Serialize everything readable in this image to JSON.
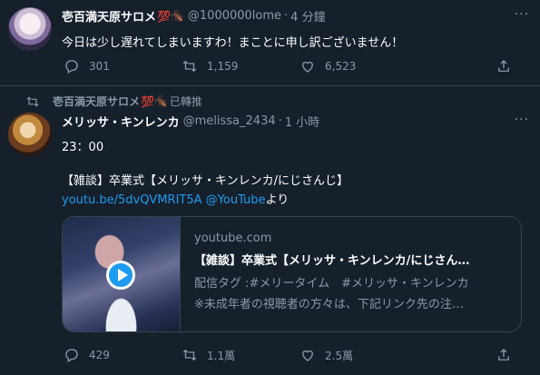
{
  "tweet1": {
    "display_name": "壱百満天原サロメ",
    "emoji": "💯🪳",
    "handle": "@1000000lome",
    "time": "4 分鐘",
    "text": "今日は少し遅れてしまいますわ！まことに申し訳ございません！",
    "replies": "301",
    "retweets": "1,159",
    "likes": "6,523"
  },
  "tweet2": {
    "retweeter_name": "壱百満天原サロメ",
    "retweeter_emoji": "💯🪳",
    "retweet_label": "已轉推",
    "display_name": "メリッサ・キンレンカ",
    "handle": "@melissa_2434",
    "time": "1 小時",
    "line1": "23：00",
    "line2": "【雑談】卒業式【メリッサ・キンレンカ/にじさんじ】",
    "link1": "youtu.be/5dvQVMRIT5A",
    "link2": "@YouTube",
    "link_suffix": "より",
    "card": {
      "domain": "youtube.com",
      "title": "【雑談】卒業式【メリッサ・キンレンカ/にじさん…",
      "desc1": "配信タグ :#メリータイム　#メリッサ・キンレンカ",
      "desc2": "※未成年者の視聴者の方々は、下記リンク先の注…"
    },
    "replies": "429",
    "retweets": "1.1萬",
    "likes": "2.5萬"
  },
  "icons": [
    "reply-icon",
    "retweet-icon",
    "like-icon",
    "share-icon",
    "more-icon",
    "play-icon"
  ],
  "colors": {
    "background": "#15202b",
    "link": "#1d9bf0",
    "muted": "#8b98a5",
    "border": "#38444d"
  }
}
